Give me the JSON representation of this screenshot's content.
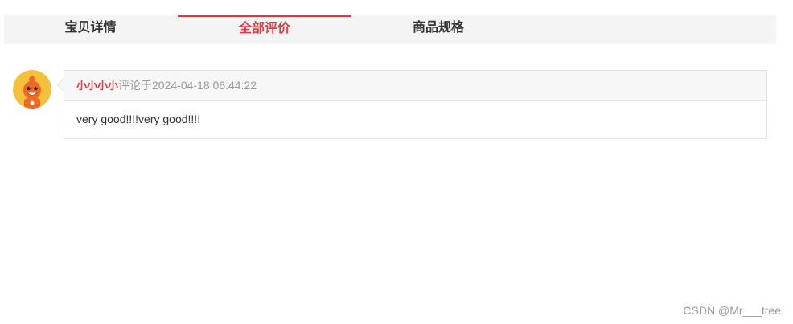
{
  "tabs": [
    {
      "label": "宝贝详情",
      "active": false
    },
    {
      "label": "全部评价",
      "active": true
    },
    {
      "label": "商品规格",
      "active": false
    }
  ],
  "colors": {
    "accent": "#e0383e",
    "tab_bar_bg": "#f4f4f4",
    "comment_head_bg": "#f7f7f7",
    "border": "#e2e2e2"
  },
  "comment": {
    "avatar_icon": "cartoon-avatar-icon",
    "user": "小小小小",
    "meta": "评论于2024-04-18 06:44:22",
    "text": "very good!!!!very good!!!!"
  },
  "watermark": "CSDN @Mr___tree"
}
